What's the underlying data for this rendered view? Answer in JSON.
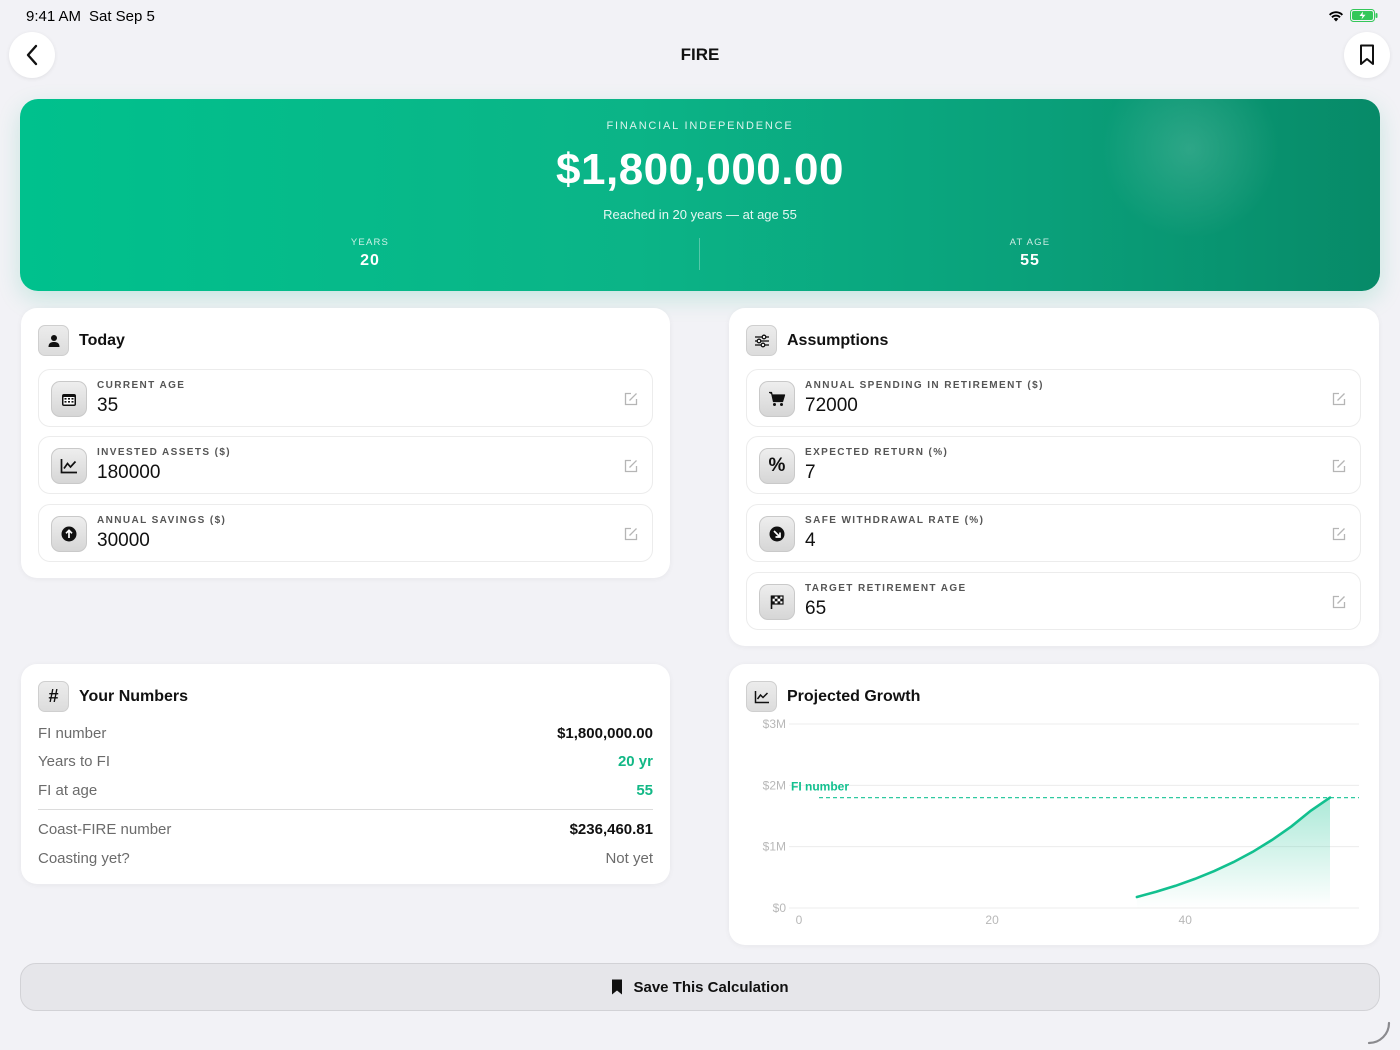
{
  "status": {
    "time": "9:41 AM",
    "date": "Sat Sep 5"
  },
  "nav": {
    "title": "FIRE"
  },
  "hero": {
    "label": "FINANCIAL INDEPENDENCE",
    "amount": "$1,800,000.00",
    "subtitle": "Reached in 20 years — at age 55",
    "years_label": "YEARS",
    "years_value": "20",
    "age_label": "AT AGE",
    "age_value": "55"
  },
  "today": {
    "title": "Today",
    "fields": [
      {
        "label": "CURRENT AGE",
        "value": "35",
        "icon": "calendar-icon"
      },
      {
        "label": "INVESTED ASSETS ($)",
        "value": "180000",
        "icon": "chart-line-icon"
      },
      {
        "label": "ANNUAL SAVINGS ($)",
        "value": "30000",
        "icon": "arrow-up-circle-icon"
      }
    ]
  },
  "assumptions": {
    "title": "Assumptions",
    "fields": [
      {
        "label": "ANNUAL SPENDING IN RETIREMENT ($)",
        "value": "72000",
        "icon": "cart-icon"
      },
      {
        "label": "EXPECTED RETURN (%)",
        "value": "7",
        "icon": "percent-icon"
      },
      {
        "label": "SAFE WITHDRAWAL RATE (%)",
        "value": "4",
        "icon": "arrow-down-right-circle-icon"
      },
      {
        "label": "TARGET RETIREMENT AGE",
        "value": "65",
        "icon": "flag-checkered-icon"
      }
    ]
  },
  "numbers": {
    "title": "Your Numbers",
    "rows": [
      {
        "label": "FI number",
        "value": "$1,800,000.00"
      },
      {
        "label": "Years to FI",
        "value": "20 yr"
      },
      {
        "label": "FI at age",
        "value": "55"
      },
      {
        "label": "Coast-FIRE number",
        "value": "$236,460.81"
      },
      {
        "label": "Coasting yet?",
        "value": "Not yet"
      }
    ]
  },
  "growth": {
    "title": "Projected Growth"
  },
  "chart_data": {
    "type": "area",
    "title": "Projected Growth",
    "x": [
      35,
      37,
      39,
      41,
      43,
      45,
      47,
      49,
      51,
      53,
      55
    ],
    "series": [
      {
        "values": [
          180000,
          265000,
          362000,
          474000,
          602000,
          749000,
          917000,
          1110000,
          1331000,
          1584000,
          1800000
        ]
      }
    ],
    "reference_line": {
      "label": "FI number",
      "value": 1800000
    },
    "x_ticks": [
      "0",
      "20",
      "40"
    ],
    "y_ticks": [
      "$0",
      "$1M",
      "$2M",
      "$3M"
    ],
    "xlim": [
      0,
      58
    ],
    "ylim": [
      0,
      3000000
    ],
    "grid": true,
    "colors": {
      "line": "#12c08f",
      "reference": "#2fc9a0"
    }
  },
  "save": {
    "label": "Save This Calculation"
  },
  "colors": {
    "accent": "#12b886",
    "hero_start": "#00c18d",
    "hero_end": "#078a68"
  }
}
